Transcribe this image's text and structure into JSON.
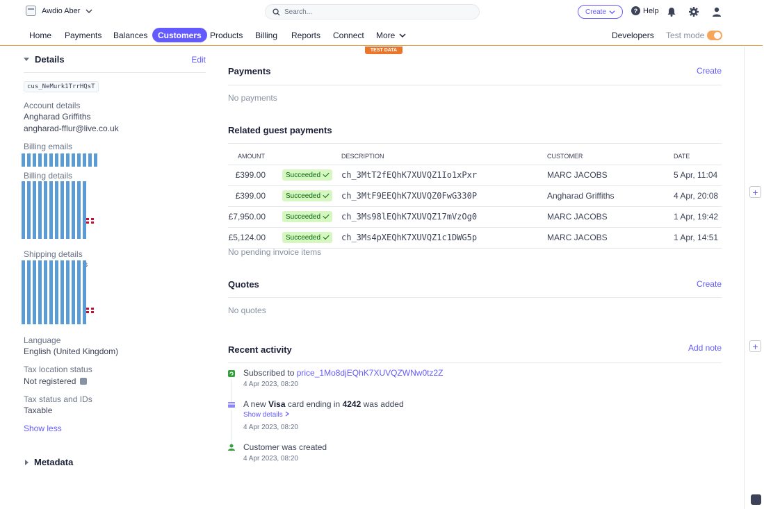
{
  "topbar": {
    "account_name": "Awdio Aber",
    "search_placeholder": "Search...",
    "create_label": "Create",
    "help_label": "Help"
  },
  "nav": {
    "items": [
      "Home",
      "Payments",
      "Balances",
      "Customers",
      "Products",
      "Billing",
      "Reports",
      "Connect",
      "More"
    ],
    "active": "Customers",
    "developers": "Developers",
    "test_mode": "Test mode",
    "test_badge": "TEST DATA"
  },
  "details": {
    "title": "Details",
    "edit": "Edit",
    "customer_id": "cus_NeMurk1TrrHQsT",
    "account_details_label": "Account details",
    "account_name": "Angharad Griffiths",
    "account_email": "angharad-fflur@live.co.uk",
    "billing_emails_label": "Billing emails",
    "billing_details_label": "Billing details",
    "shipping_details_label": "Shipping details",
    "shipping_fragment": "s",
    "language_label": "Language",
    "language_value": "English (United Kingdom)",
    "tax_location_label": "Tax location status",
    "tax_location_value": "Not registered",
    "tax_status_label": "Tax status and IDs",
    "tax_status_value": "Taxable",
    "show_less": "Show less",
    "metadata_title": "Metadata"
  },
  "payments": {
    "title": "Payments",
    "create": "Create",
    "empty": "No payments"
  },
  "guest_payments": {
    "title": "Related guest payments",
    "columns": [
      "AMOUNT",
      "DESCRIPTION",
      "CUSTOMER",
      "DATE"
    ],
    "rows": [
      {
        "amount": "£399.00",
        "status": "Succeeded",
        "description": "ch_3MtT2fEQhK7XUVQZ1Io1xPxr",
        "customer": "MARC JACOBS",
        "date": "5 Apr, 11:04"
      },
      {
        "amount": "£399.00",
        "status": "Succeeded",
        "description": "ch_3MtF9EEQhK7XUVQZ0FwG330P",
        "customer": "Angharad Griffiths",
        "date": "4 Apr, 20:08"
      },
      {
        "amount": "£7,950.00",
        "status": "Succeeded",
        "description": "ch_3Ms98lEQhK7XUVQZ17mVzOg0",
        "customer": "MARC JACOBS",
        "date": "1 Apr, 19:42"
      },
      {
        "amount": "£5,124.00",
        "status": "Succeeded",
        "description": "ch_3Ms4pXEQhK7XUVQZ1c1DWG5p",
        "customer": "MARC JACOBS",
        "date": "1 Apr, 14:51"
      }
    ],
    "pending": "No pending invoice items"
  },
  "quotes": {
    "title": "Quotes",
    "create": "Create",
    "empty": "No quotes"
  },
  "activity": {
    "title": "Recent activity",
    "add_note": "Add note",
    "items": [
      {
        "prefix": "Subscribed to ",
        "link": "price_1Mo8djEQhK7XUVQZWNw0tz2Z",
        "time": "4 Apr 2023, 08:20",
        "icon": "subscription-icon",
        "color": "#33a03b"
      },
      {
        "prefix": "A new ",
        "bold1": "Visa",
        "mid": " card ending in ",
        "bold2": "4242",
        "suffix": " was added",
        "show_details": "Show details",
        "time": "4 Apr 2023, 08:20",
        "icon": "card-icon",
        "color": "#635bff"
      },
      {
        "prefix": "Customer was created",
        "time": "4 Apr 2023, 08:20",
        "icon": "person-icon",
        "color": "#33a03b"
      }
    ]
  },
  "colors": {
    "accent": "#635bff",
    "test_orange": "#e8762b",
    "success_bg": "#d7f7c2",
    "success_text": "#05690d",
    "redaction_blue": "#5b9bd5"
  }
}
